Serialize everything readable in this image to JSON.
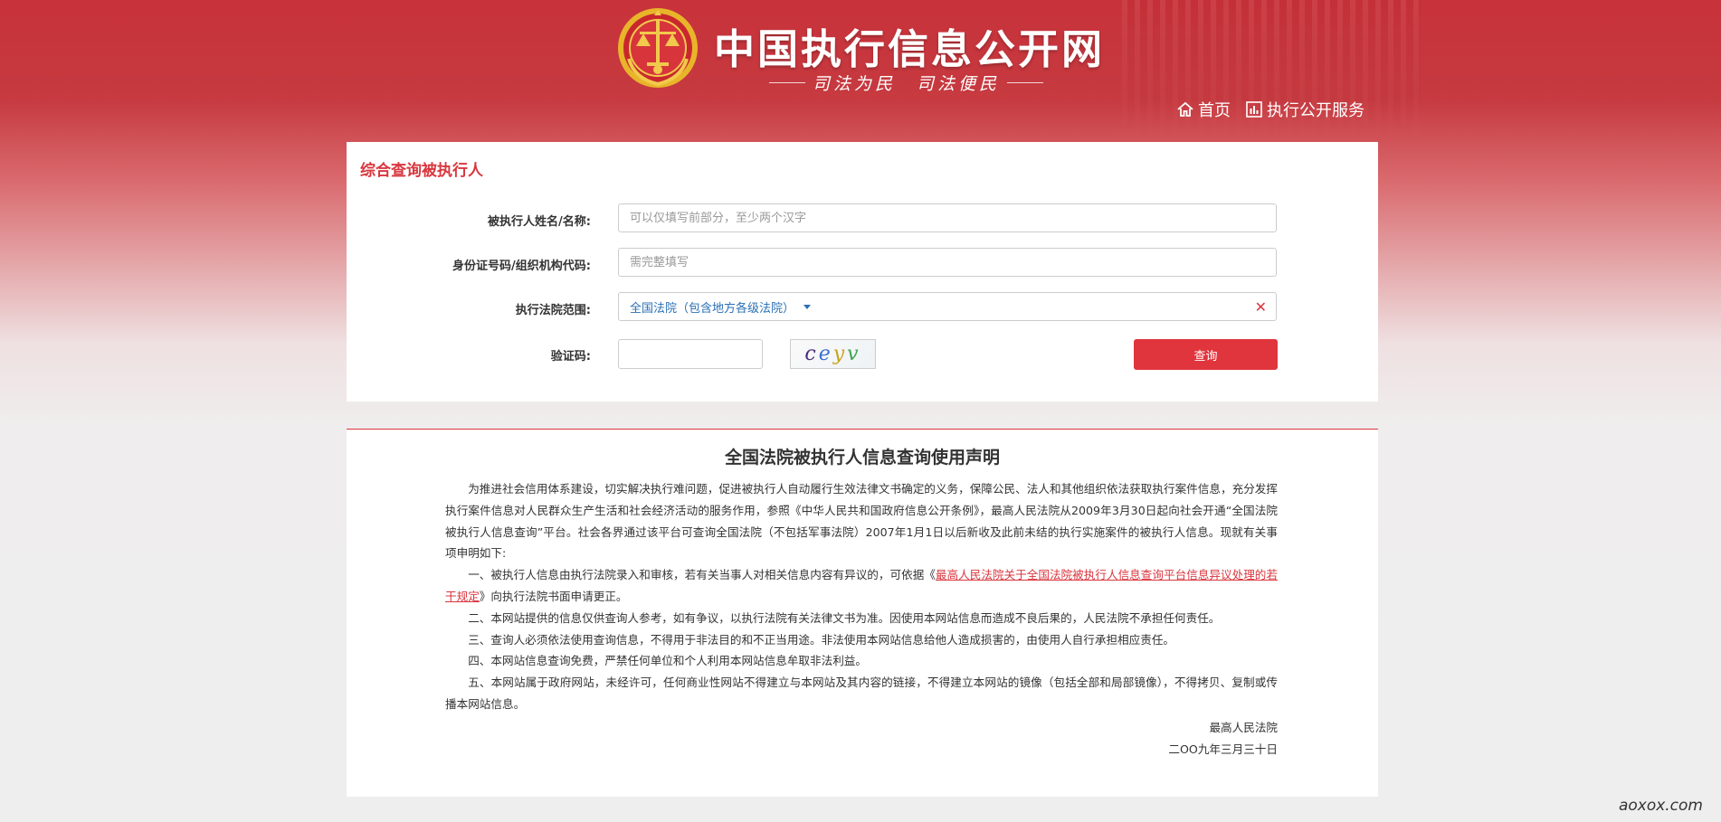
{
  "header": {
    "site_title": "中国执行信息公开网",
    "slogan": "司法为民　司法便民",
    "nav": [
      {
        "label": "首页",
        "icon": "home-icon"
      },
      {
        "label": "执行公开服务",
        "icon": "chart-icon"
      }
    ]
  },
  "search": {
    "title": "综合查询被执行人",
    "name_label": "被执行人姓名/名称:",
    "name_placeholder": "可以仅填写前部分，至少两个汉字",
    "id_label": "身份证号码/组织机构代码:",
    "id_placeholder": "需完整填写",
    "court_label": "执行法院范围:",
    "court_value": "全国法院（包含地方各级法院）",
    "captcha_label": "验证码:",
    "captcha_text": "ceyv",
    "query_button": "查询"
  },
  "declaration": {
    "title": "全国法院被执行人信息查询使用声明",
    "intro": "为推进社会信用体系建设，切实解决执行难问题，促进被执行人自动履行生效法律文书确定的义务，保障公民、法人和其他组织依法获取执行案件信息，充分发挥执行案件信息对人民群众生产生活和社会经济活动的服务作用，参照《中华人民共和国政府信息公开条例》，最高人民法院从2009年3月30日起向社会开通“全国法院被执行人信息查询”平台。社会各界通过该平台可查询全国法院（不包括军事法院）2007年1月1日以后新收及此前未结的执行实施案件的被执行人信息。现就有关事项申明如下:",
    "item1_pre": "一、被执行人信息由执行法院录入和审核，若有关当事人对相关信息内容有异议的，可依据《",
    "item1_link": "最高人民法院关于全国法院被执行人信息查询平台信息异议处理的若干规定",
    "item1_post": "》向执行法院书面申请更正。",
    "item2": "二、本网站提供的信息仅供查询人参考，如有争议，以执行法院有关法律文书为准。因使用本网站信息而造成不良后果的，人民法院不承担任何责任。",
    "item3": "三、查询人必须依法使用查询信息，不得用于非法目的和不正当用途。非法使用本网站信息给他人造成损害的，由使用人自行承担相应责任。",
    "item4": "四、本网站信息查询免费，严禁任何单位和个人利用本网站信息牟取非法利益。",
    "item5": "五、本网站属于政府网站，未经许可，任何商业性网站不得建立与本网站及其内容的链接，不得建立本网站的镜像（包括全部和局部镜像），不得拷贝、复制或传播本网站信息。",
    "signature": "最高人民法院",
    "date": "二OO九年三月三十日"
  },
  "watermark": "aoxox.com",
  "colors": {
    "brand_red": "#d9363e",
    "link_blue": "#2a6fb4"
  }
}
